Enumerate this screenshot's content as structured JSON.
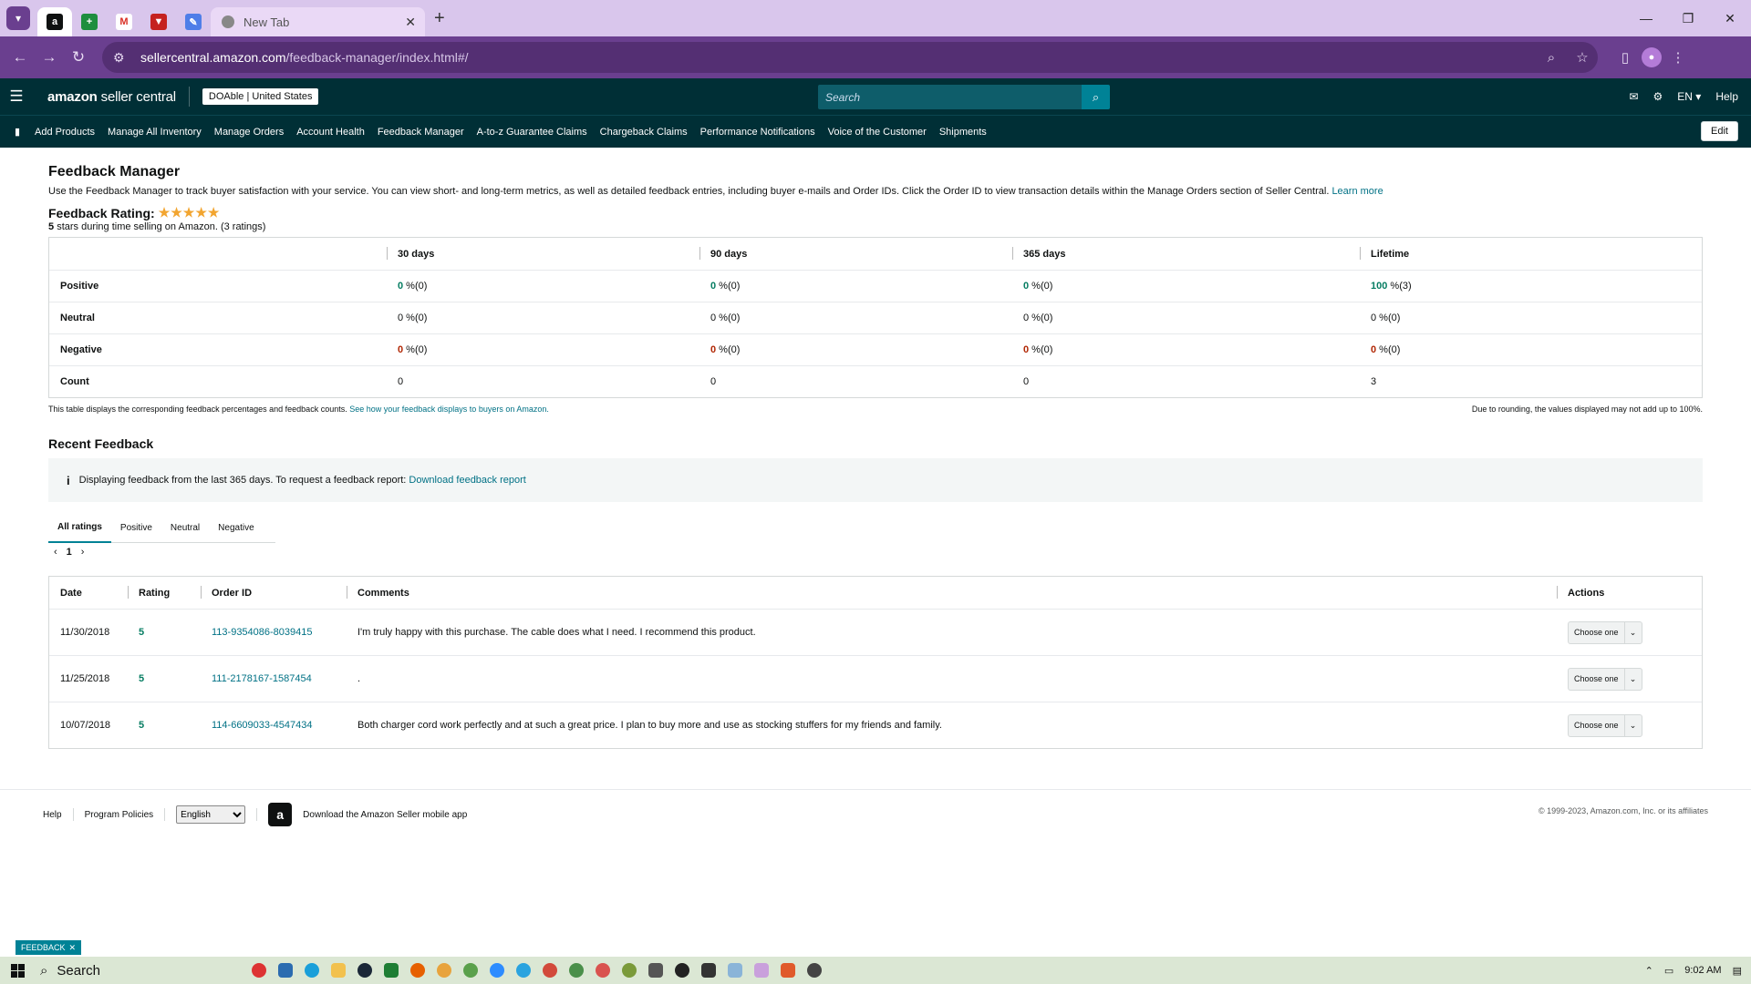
{
  "browser": {
    "active_tab_favicon": "a",
    "new_tab_label": "New Tab",
    "url_host": "sellercentral.amazon.com",
    "url_path": "/feedback-manager/index.html#/"
  },
  "header": {
    "logo_main": "amazon",
    "logo_sub": "seller central",
    "store_name": "DOAble",
    "store_region": "United States",
    "search_placeholder": "Search",
    "language": "EN",
    "help": "Help"
  },
  "nav": {
    "items": [
      "Add Products",
      "Manage All Inventory",
      "Manage Orders",
      "Account Health",
      "Feedback Manager",
      "A-to-z Guarantee Claims",
      "Chargeback Claims",
      "Performance Notifications",
      "Voice of the Customer",
      "Shipments"
    ],
    "edit_label": "Edit"
  },
  "page": {
    "title": "Feedback Manager",
    "intro": "Use the Feedback Manager to track buyer satisfaction with your service. You can view short- and long-term metrics, as well as detailed feedback entries, including buyer e-mails and Order IDs. Click the Order ID to view transaction details within the Manage Orders section of Seller Central.",
    "learn_more": "Learn more",
    "rating_label": "Feedback Rating:",
    "stars": "★★★★★",
    "rating_sub_stars": "5",
    "rating_sub_text": "stars during time selling on Amazon. (3 ratings)"
  },
  "stats": {
    "columns": [
      "30 days",
      "90 days",
      "365 days",
      "Lifetime"
    ],
    "rows": [
      {
        "label": "Positive",
        "cells": [
          {
            "v": "0",
            "t": " %(0)"
          },
          {
            "v": "0",
            "t": " %(0)"
          },
          {
            "v": "0",
            "t": " %(0)"
          },
          {
            "v": "100",
            "t": " %(3)"
          }
        ]
      },
      {
        "label": "Neutral",
        "cells": [
          {
            "v": "0",
            "t": " %(0)"
          },
          {
            "v": "0",
            "t": " %(0)"
          },
          {
            "v": "0",
            "t": " %(0)"
          },
          {
            "v": "0",
            "t": " %(0)"
          }
        ]
      },
      {
        "label": "Negative",
        "cells": [
          {
            "v": "0",
            "t": " %(0)"
          },
          {
            "v": "0",
            "t": " %(0)"
          },
          {
            "v": "0",
            "t": " %(0)"
          },
          {
            "v": "0",
            "t": " %(0)"
          }
        ]
      },
      {
        "label": "Count",
        "cells": [
          {
            "v": "0",
            "t": ""
          },
          {
            "v": "0",
            "t": ""
          },
          {
            "v": "0",
            "t": ""
          },
          {
            "v": "3",
            "t": ""
          }
        ]
      }
    ],
    "foot_text": "This table displays the corresponding feedback percentages and feedback counts.",
    "foot_link": "See how your feedback displays to buyers on Amazon.",
    "rounding_note": "Due to rounding, the values displayed may not add up to 100%."
  },
  "recent": {
    "title": "Recent Feedback",
    "info_icon": "i",
    "info_text": "Displaying feedback from the last 365 days. To request a feedback report:",
    "info_link": "Download feedback report",
    "tabs": [
      "All ratings",
      "Positive",
      "Neutral",
      "Negative"
    ],
    "page_prev": "‹",
    "page_num": "1",
    "page_next": "›",
    "columns": [
      "Date",
      "Rating",
      "Order ID",
      "Comments",
      "Actions"
    ],
    "rows": [
      {
        "date": "11/30/2018",
        "rating": "5",
        "order": "113-9354086-8039415",
        "comment": "I'm truly happy with this purchase. The cable does what I need. I recommend this product.",
        "action": "Choose one"
      },
      {
        "date": "11/25/2018",
        "rating": "5",
        "order": "111-2178167-1587454",
        "comment": ".",
        "action": "Choose one"
      },
      {
        "date": "10/07/2018",
        "rating": "5",
        "order": "114-6609033-4547434",
        "comment": "Both charger cord work perfectly and at such a great price. I plan to buy more and use as stocking stuffers for my friends and family.",
        "action": "Choose one"
      }
    ]
  },
  "footer": {
    "help": "Help",
    "policies": "Program Policies",
    "language": "English",
    "app_text": "Download the Amazon Seller mobile app",
    "copyright": "© 1999-2023, Amazon.com, Inc. or its affiliates"
  },
  "feedback_tag": "FEEDBACK",
  "taskbar": {
    "search": "Search",
    "time": "9:02 AM"
  },
  "colors": {
    "header_bg": "#002f36",
    "link": "#007185",
    "positive": "#067d62",
    "negative": "#b12704",
    "browser_accent": "#6a3f8f"
  }
}
